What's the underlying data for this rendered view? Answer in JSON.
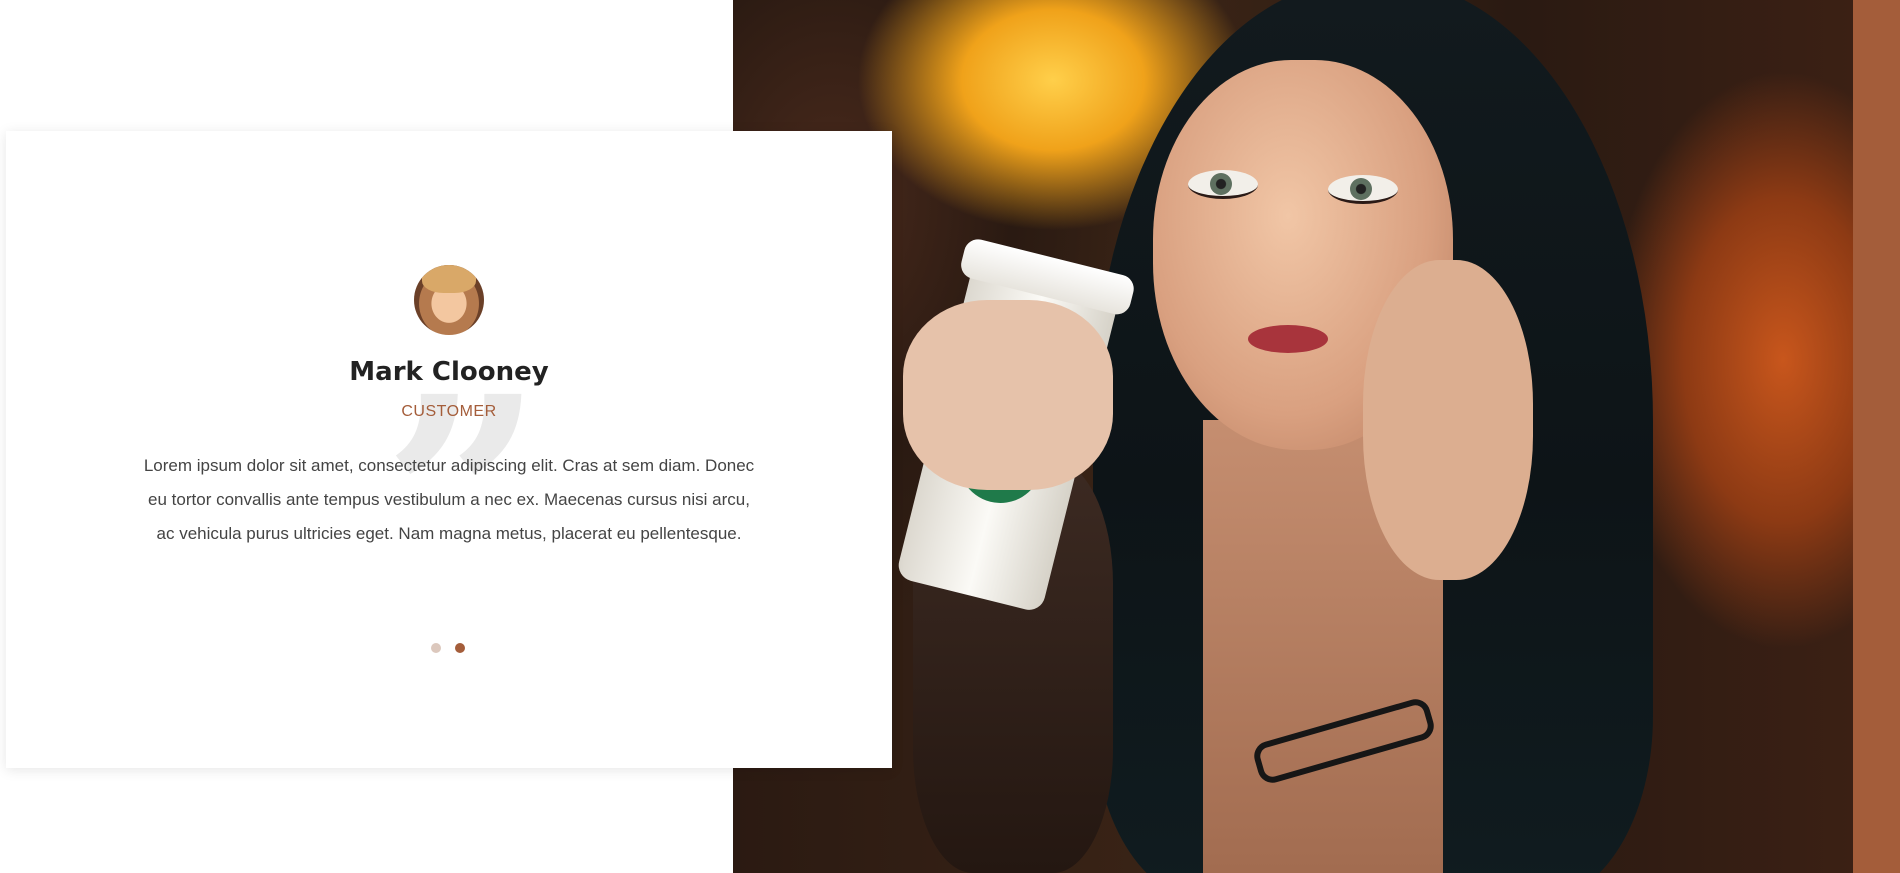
{
  "testimonial": {
    "name": "Mark Clooney",
    "role": "CUSTOMER",
    "text": "Lorem ipsum dolor sit amet, consectetur adipiscing elit. Cras at sem diam. Donec eu tortor convallis ante tempus vestibulum a nec ex. Maecenas cursus nisi arcu, ac vehicula purus ultricies eget. Nam magna metus, placerat eu pellentesque.",
    "quote_icon": "quote-icon",
    "avatar_icon": "avatar"
  },
  "slider": {
    "dots": [
      {
        "active": false
      },
      {
        "active": true
      }
    ]
  },
  "colors": {
    "accent": "#a45d3a",
    "dot_inactive": "#dcc8bd",
    "dot_active": "#a45d3a",
    "quote_mark": "#eaeaea"
  },
  "photo": {
    "description_icon": "photo-woman-with-coffee-cup"
  }
}
